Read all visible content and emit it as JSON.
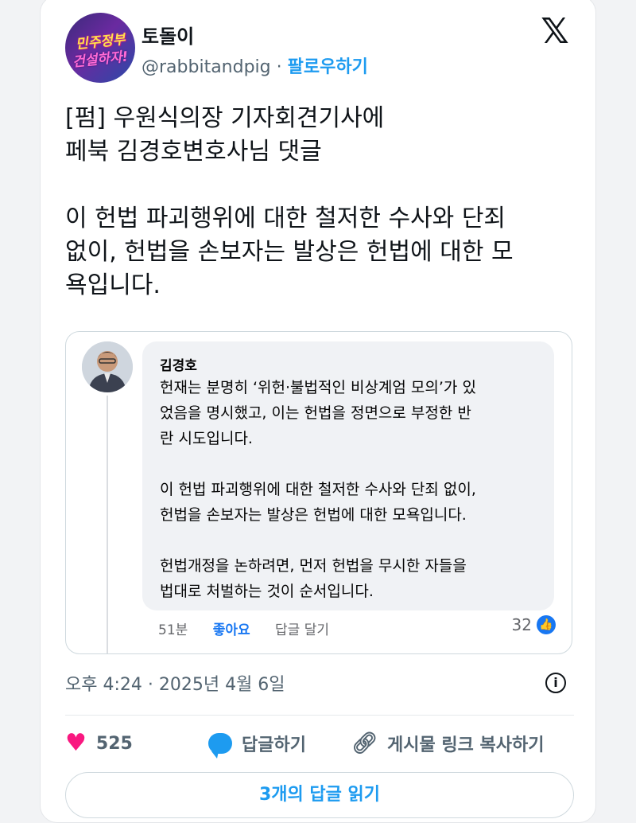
{
  "author": {
    "name": "토돌이",
    "handle": "@rabbitandpig",
    "separator": "·",
    "follow_label": "팔로우하기",
    "avatar_text_line1": "민주정부",
    "avatar_text_line2": "건설하자!"
  },
  "tweet": {
    "text": "[펌] 우원식의장 기자회견기사에\n페북 김경호변호사님 댓글\n\n이 헌법 파괴행위에 대한 철저한 수사와 단죄\n없이, 헌법을 손보자는 발상은 헌법에 대한 모\n욕입니다."
  },
  "embedded_comment": {
    "commenter_name": "김경호",
    "comment_text": "헌재는 분명히 ‘위헌·불법적인 비상계엄 모의’가 있\n었음을 명시했고, 이는 헌법을 정면으로 부정한 반\n란 시도입니다.\n\n이 헌법 파괴행위에 대한 철저한 수사와 단죄 없이,\n헌법을 손보자는 발상은 헌법에 대한 모욕입니다.\n\n헌법개정을 논하려면, 먼저 헌법을 무시한 자들을\n법대로 처벌하는 것이 순서입니다.",
    "time": "51분",
    "like_label": "좋아요",
    "reply_label": "답글 달기",
    "reaction_count": "32"
  },
  "meta": {
    "timestamp": "오후 4:24 · 2025년 4월 6일"
  },
  "engagement": {
    "like_count": "525",
    "reply_label": "답글하기",
    "copy_link_label": "게시물 링크 복사하기",
    "read_replies_label": "3개의 답글 읽기"
  },
  "icons": {
    "brand": "x-logo-icon",
    "info": "info-icon",
    "like": "heart-icon",
    "reply": "reply-bubble-icon",
    "link": "link-icon"
  },
  "colors": {
    "accent": "#1d9bf0",
    "like": "#f91880",
    "facebook_blue": "#1877f2"
  }
}
